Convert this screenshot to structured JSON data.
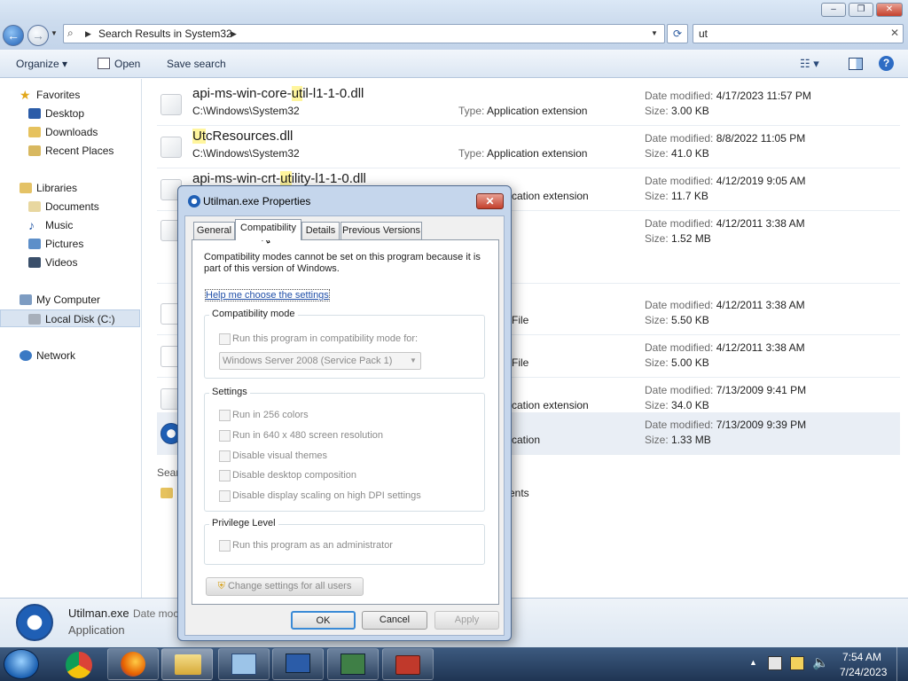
{
  "window": {
    "address_path": "Search Results in System32",
    "search_value": "ut",
    "controls": {
      "minimize": "–",
      "maximize": "❐",
      "close": "✕"
    }
  },
  "toolbar": {
    "organize": "Organize",
    "open": "Open",
    "save_search": "Save search"
  },
  "nav": {
    "favorites": "Favorites",
    "desktop": "Desktop",
    "downloads": "Downloads",
    "recent_places": "Recent Places",
    "libraries": "Libraries",
    "documents": "Documents",
    "music": "Music",
    "pictures": "Pictures",
    "videos": "Videos",
    "my_computer": "My Computer",
    "local_disk": "Local Disk (C:)",
    "network": "Network"
  },
  "labels": {
    "type": "Type:",
    "date_modified": "Date modified:",
    "size": "Size:"
  },
  "files": [
    {
      "name_pre": "api-ms-win-core-",
      "name_hl": "ut",
      "name_post": "il-l1-1-0.dll",
      "path": "C:\\Windows\\System32",
      "type": "Application extension",
      "date": "4/17/2023 11:57 PM",
      "size": "3.00 KB"
    },
    {
      "name_pre": "",
      "name_hl": "Ut",
      "name_post": "cResources.dll",
      "path": "C:\\Windows\\System32",
      "type": "Application extension",
      "date": "8/8/2022 11:05 PM",
      "size": "41.0 KB"
    },
    {
      "name_pre": "api-ms-win-crt-",
      "name_hl": "ut",
      "name_post": "ility-l1-1-0.dll",
      "type_partial": "cation extension",
      "date": "4/12/2019 9:05 AM",
      "size": "11.7 KB"
    },
    {
      "date": "4/12/2011 3:38 AM",
      "size": "1.52 MB"
    },
    {
      "type_partial": "File",
      "date": "4/12/2011 3:38 AM",
      "size": "5.50 KB"
    },
    {
      "type_partial": "File",
      "date": "4/12/2011 3:38 AM",
      "size": "5.00 KB"
    },
    {
      "type_partial": "cation extension",
      "date": "7/13/2009 9:41 PM",
      "size": "34.0 KB"
    },
    {
      "type_partial": "cation",
      "date": "7/13/2009 9:39 PM",
      "size": "1.33 MB"
    }
  ],
  "search_again_partial": "Sear",
  "contents_partial": "ents",
  "details_pane": {
    "name": "Utilman.exe",
    "date_partial": "Date moc",
    "type": "Application"
  },
  "dialog": {
    "title": "Utilman.exe Properties",
    "close": "✕",
    "tabs": [
      "General",
      "Compatibility",
      "Details",
      "Previous Versions"
    ],
    "notice": "Compatibility modes cannot be set on this program because it is part of this version of Windows.",
    "help_link": "Help me choose the settings",
    "compat_mode_group": "Compatibility mode",
    "compat_mode_checkbox": "Run this program in compatibility mode for:",
    "compat_mode_select": "Windows Server 2008 (Service Pack 1)",
    "settings_group": "Settings",
    "settings": [
      "Run in 256 colors",
      "Run in 640 x 480 screen resolution",
      "Disable visual themes",
      "Disable desktop composition",
      "Disable display scaling on high DPI settings"
    ],
    "privilege_group": "Privilege Level",
    "privilege_checkbox": "Run this program as an administrator",
    "change_all_users": "Change settings for all users",
    "ok": "OK",
    "cancel": "Cancel",
    "apply": "Apply"
  },
  "taskbar": {
    "time": "7:54 AM",
    "date": "7/24/2023"
  }
}
